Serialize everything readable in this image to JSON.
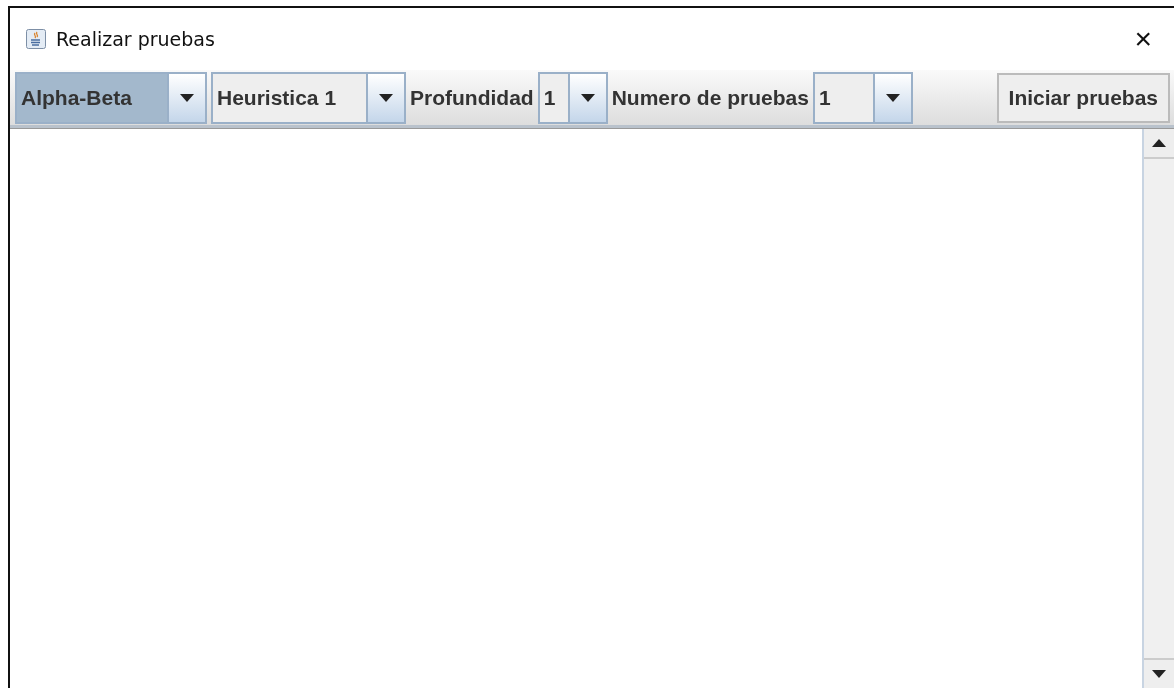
{
  "window": {
    "title": "Realizar pruebas",
    "close": "×"
  },
  "toolbar": [
    {
      "kind": "combo",
      "value": "Alpha-Beta",
      "focused": true
    },
    {
      "kind": "combo",
      "value": "Heuristica 1",
      "focused": false
    },
    {
      "kind": "label",
      "text": "Profundidad"
    },
    {
      "kind": "combo",
      "value": "1",
      "focused": false
    },
    {
      "kind": "label",
      "text": "Numero de pruebas"
    },
    {
      "kind": "combo",
      "value": "1",
      "focused": false
    },
    {
      "kind": "button",
      "text": "Iniciar pruebas"
    }
  ]
}
